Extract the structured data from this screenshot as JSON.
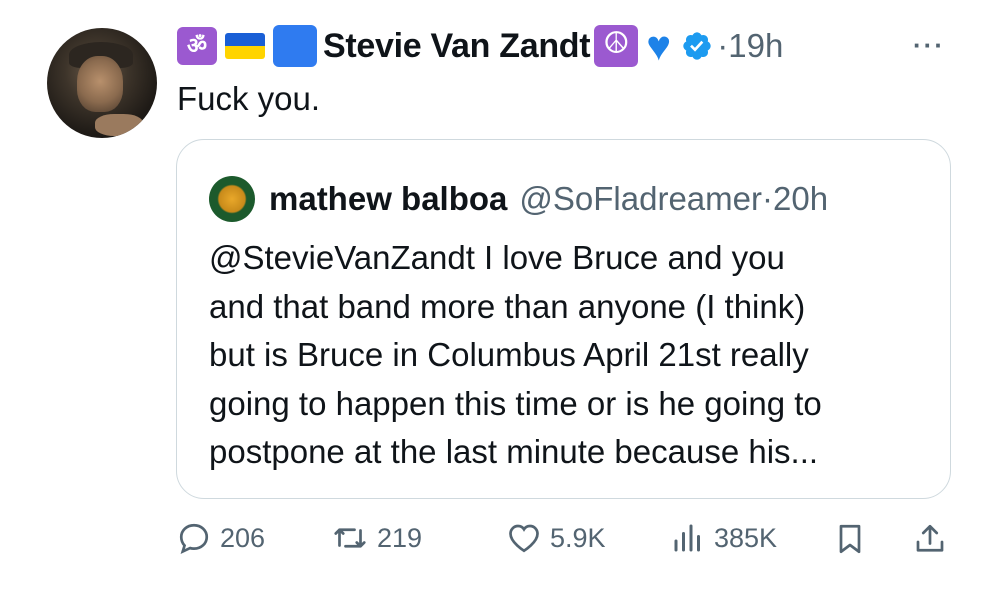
{
  "tweet": {
    "author_name": "Stevie Van Zandt",
    "name_emojis": [
      "om-symbol",
      "ukraine-flag",
      "blue-square",
      "peace-symbol",
      "blue-heart"
    ],
    "separator": "·",
    "time": "19h",
    "more_label": "···",
    "text": "Fuck you.",
    "colors": {
      "verified": "#1d9bf0",
      "secondary_text": "#536471",
      "heart": "#1d82e8"
    }
  },
  "quoted": {
    "name": "mathew balboa",
    "handle": "@SoFladreamer",
    "separator": "·",
    "time": "20h",
    "lines": [
      "@StevieVanZandt I love Bruce and you",
      "and that band more than anyone (I think)",
      "but is Bruce in Columbus April 21st really",
      "going to happen this time or is he going to",
      "postpone at the last minute because his..."
    ]
  },
  "actions": {
    "replies": "206",
    "reposts": "219",
    "likes": "5.9K",
    "views": "385K"
  }
}
